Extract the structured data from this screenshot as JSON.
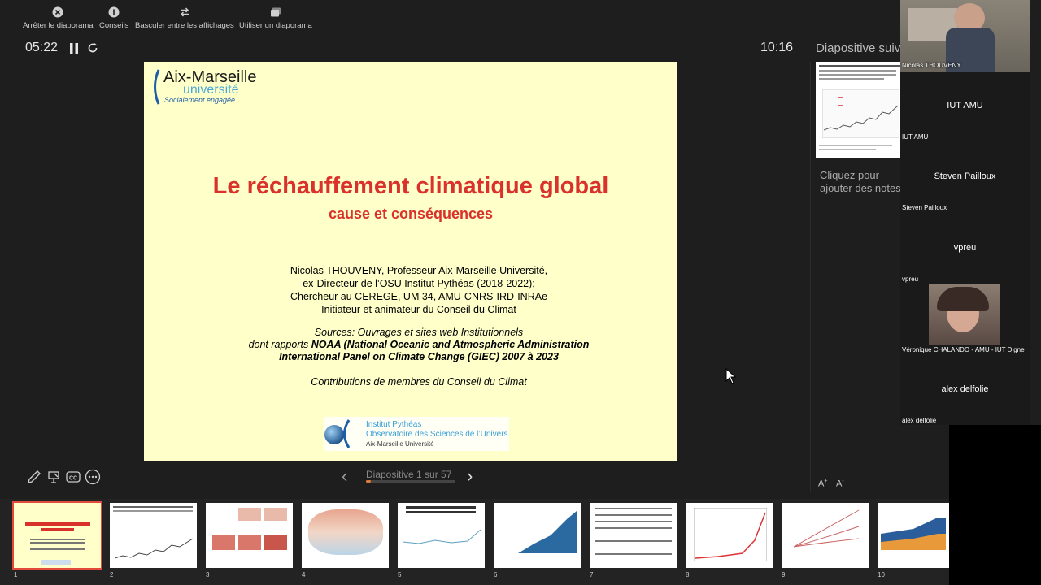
{
  "toolbar": {
    "items": [
      {
        "label": "Arrêter le diaporama",
        "icon": "close-circle-icon"
      },
      {
        "label": "Conseils",
        "icon": "info-icon"
      },
      {
        "label": "Basculer entre les affichages",
        "icon": "swap-icon"
      },
      {
        "label": "Utiliser un diaporama",
        "icon": "slides-icon"
      }
    ]
  },
  "timer": "05:22",
  "clock": "10:16",
  "slide": {
    "logo_main": "Aix-Marseille",
    "logo_sub": "université",
    "logo_tagline": "Socialement engagée",
    "title": "Le réchauffement climatique global",
    "subtitle": "cause et conséquences",
    "author_lines": [
      "Nicolas THOUVENY, Professeur Aix-Marseille Université,",
      "ex-Directeur de l’OSU Institut Pythéas (2018-2022);",
      "Chercheur au CEREGE, UM 34, AMU-CNRS-IRD-INRAe",
      "Initiateur et animateur du Conseil du Climat"
    ],
    "sources_line1": "Sources: Ouvrages et sites web Institutionnels",
    "sources_line2_prefix": "dont rapports ",
    "sources_line2_bold": "NOAA (National Oceanic and Atmospheric Administration",
    "sources_line3": "International Panel on Climate Change (GIEC) 2007 à 2023",
    "contrib": "Contributions de membres du Conseil du Climat",
    "pytheas_line1": "Institut Pythéas",
    "pytheas_line2": "Observatoire des Sciences de l’Univers",
    "pytheas_line3": "Aix-Marseille Université"
  },
  "next_slide_label": "Diapositive suivante",
  "notes_placeholder": "Cliquez pour ajouter des notes",
  "participants": {
    "cam1_name": "Nicolas THOUVENY",
    "p2_center": "IUT AMU",
    "p2_small": "IUT AMU",
    "p3_center": "Steven Pailloux",
    "p3_small": "Steven Pailloux",
    "p4_center": "vpreu",
    "p4_small": "vpreu",
    "cam2_name": "Véronique CHALANDO - AMU -  IUT Digne",
    "p6_center": "alex delfolie",
    "p6_small": "alex delfolie"
  },
  "slide_counter": "Diapositive 1 sur 57",
  "progress_fraction": 0.0175,
  "filmstrip": {
    "numbers": [
      "1",
      "2",
      "3",
      "4",
      "5",
      "6",
      "7",
      "8",
      "9",
      "10"
    ],
    "selected": "1"
  },
  "colors": {
    "accent": "#e24a3c",
    "slide_bg": "#ffffc9",
    "title_red": "#d9312b"
  }
}
